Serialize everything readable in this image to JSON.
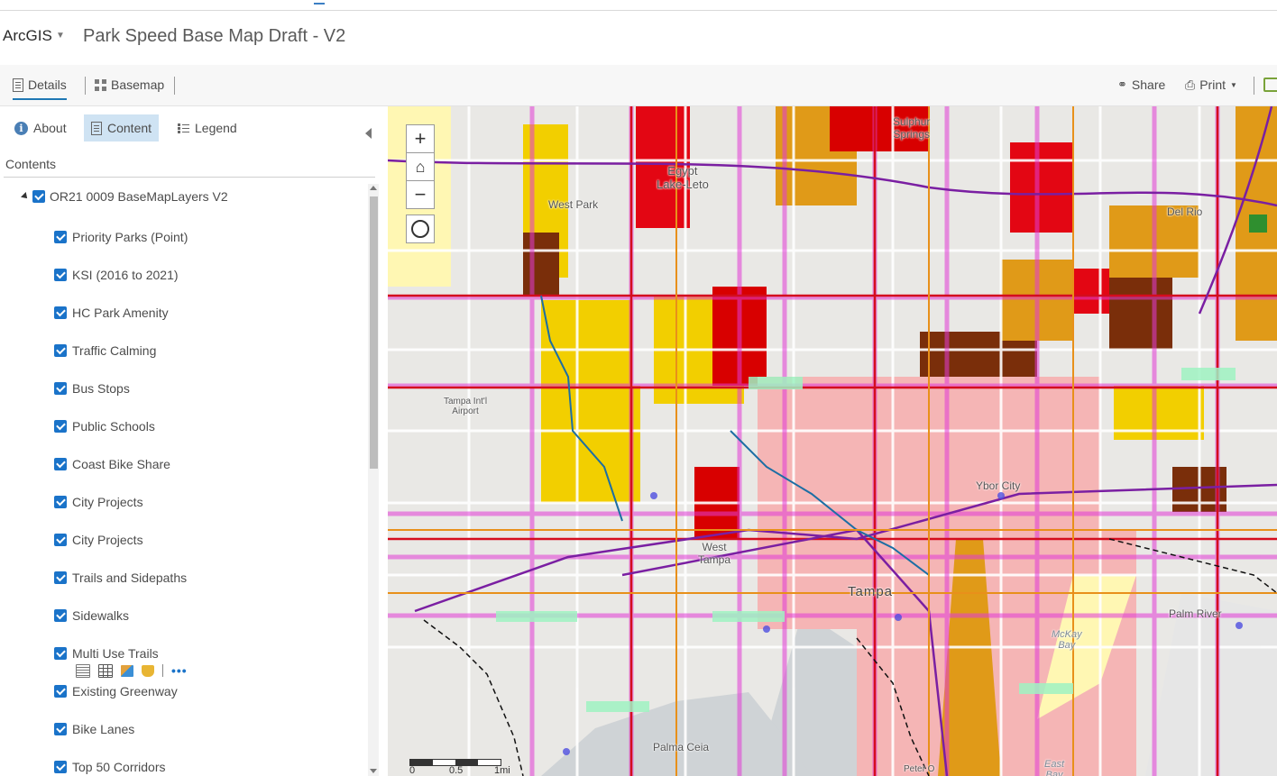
{
  "header": {
    "brand": "ArcGIS",
    "map_title": "Park Speed Base Map Draft - V2"
  },
  "toolbar": {
    "details_label": "Details",
    "basemap_label": "Basemap",
    "share_label": "Share",
    "print_label": "Print"
  },
  "sidebar": {
    "tabs": {
      "about": "About",
      "content": "Content",
      "legend": "Legend"
    },
    "contents_heading": "Contents",
    "group_label": "OR21 0009 BaseMapLayers V2",
    "layers": [
      "Priority Parks (Point)",
      "KSI (2016 to 2021)",
      "HC Park Amenity",
      "Traffic Calming",
      "Bus Stops",
      "Public Schools",
      "Coast Bike Share",
      "City Projects",
      "City Projects",
      "Trails and Sidepaths",
      "Sidewalks",
      "Multi Use Trails",
      "Existing Greenway",
      "Bike Lanes",
      "Top 50 Corridors"
    ]
  },
  "map": {
    "places": {
      "sulphur": "Sulphur\nSprings",
      "egypt": "Egypt\nLake-Leto",
      "west_park": "West Park",
      "del_rio": "Del Rio",
      "airport": "Tampa Int'l\nAirport",
      "ybor": "Ybor City",
      "west_tampa": "West\nTampa",
      "tampa": "Tampa",
      "palm_river": "Palm River",
      "mckay": "McKay\nBay",
      "palma_ceia": "Palma Ceia",
      "peter_o": "Peter O",
      "east_bay": "East\nBay"
    },
    "scale": {
      "zero": "0",
      "half": "0.5",
      "one": "1mi"
    }
  }
}
